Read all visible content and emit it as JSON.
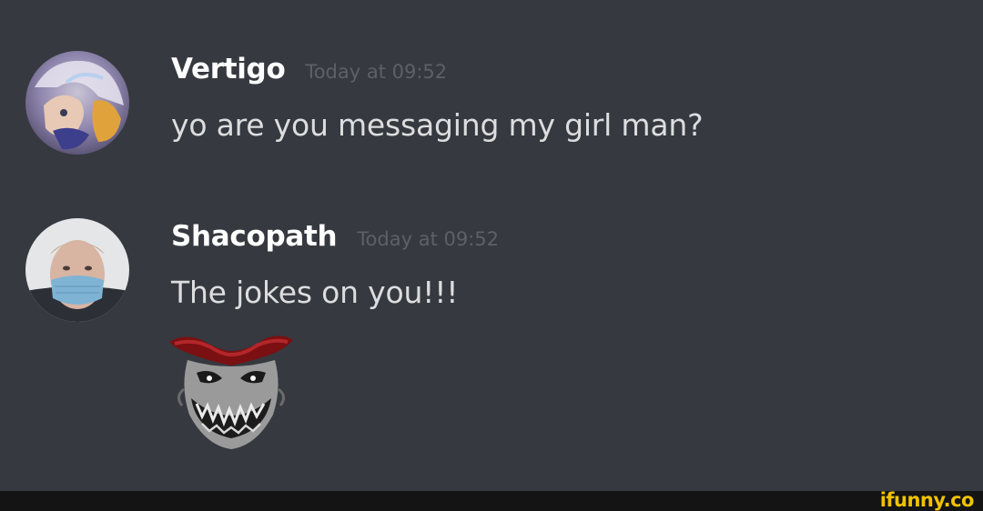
{
  "messages": [
    {
      "username": "Vertigo",
      "timestamp": "Today at 09:52",
      "content": "yo are you messaging my girl man?",
      "avatar_icon": "anime-character-avatar"
    },
    {
      "username": "Shacopath",
      "timestamp": "Today at 09:52",
      "content": "The jokes on you!!!",
      "avatar_icon": "masked-person-avatar",
      "attachment_icon": "grinning-jester-emoji"
    }
  ],
  "watermark": "ifunny.co",
  "colors": {
    "background": "#36393f",
    "username": "#ffffff",
    "text": "#dcddde",
    "timestamp": "#5d6068",
    "watermark": "#f2c200"
  }
}
